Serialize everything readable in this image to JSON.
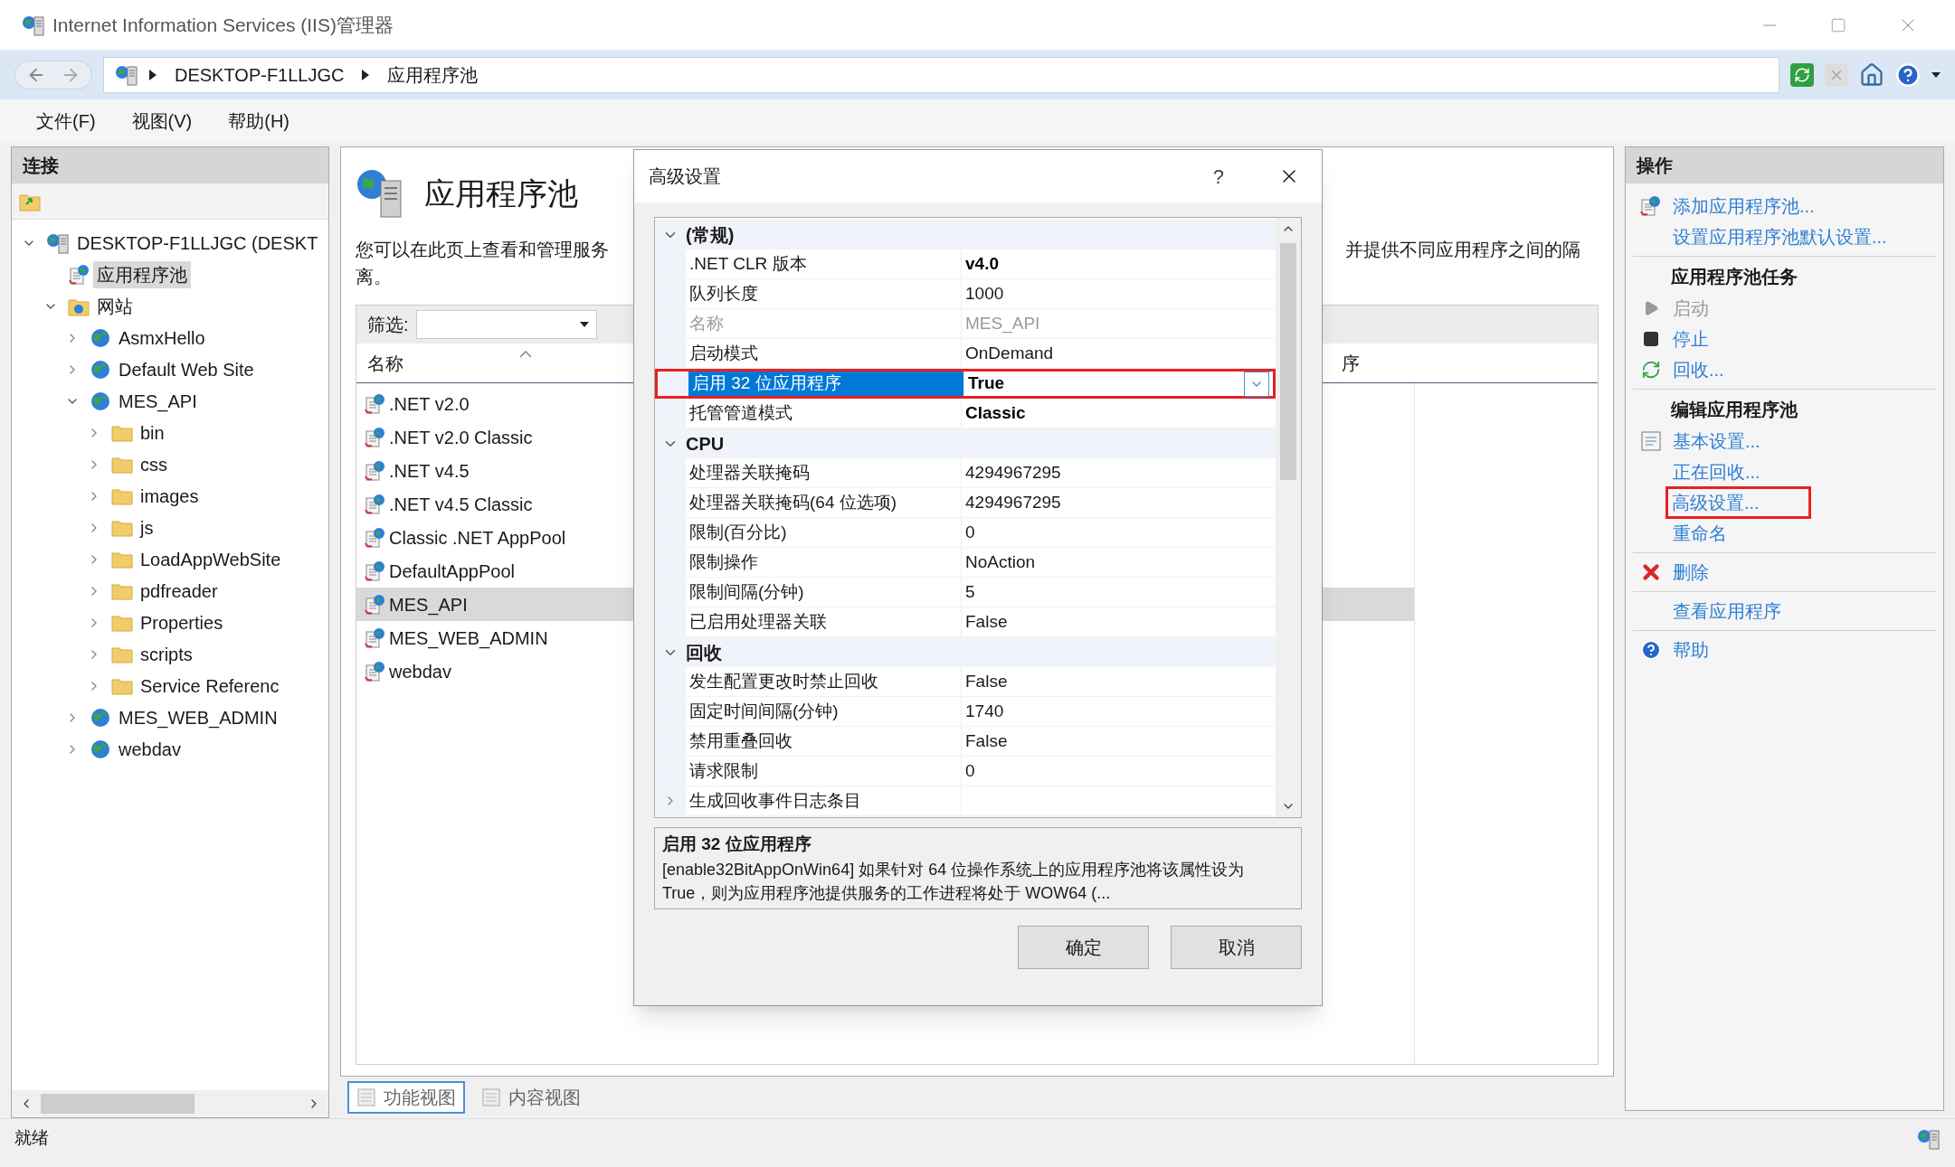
{
  "window": {
    "title": "Internet Information Services (IIS)管理器"
  },
  "address_bar": {
    "segments": [
      "DESKTOP-F1LLJGC",
      "应用程序池"
    ]
  },
  "menu": [
    "文件(F)",
    "视图(V)",
    "帮助(H)"
  ],
  "connections": {
    "title": "连接",
    "tree": [
      {
        "label": "DESKTOP-F1LLJGC (DESKT",
        "kind": "server",
        "expanded": true,
        "selected": false,
        "children": [
          {
            "label": "应用程序池",
            "kind": "pool",
            "selected": true
          },
          {
            "label": "网站",
            "kind": "sites",
            "expanded": true,
            "selected": false,
            "children": [
              {
                "label": "AsmxHello",
                "kind": "site",
                "expanded": false,
                "selected": false
              },
              {
                "label": "Default Web Site",
                "kind": "site",
                "expanded": false,
                "selected": false
              },
              {
                "label": "MES_API",
                "kind": "site",
                "expanded": true,
                "selected": false,
                "children": [
                  {
                    "label": "bin",
                    "kind": "folder",
                    "expanded": false,
                    "selected": false
                  },
                  {
                    "label": "css",
                    "kind": "folder",
                    "expanded": false,
                    "selected": false
                  },
                  {
                    "label": "images",
                    "kind": "folder",
                    "expanded": false,
                    "selected": false
                  },
                  {
                    "label": "js",
                    "kind": "folder",
                    "expanded": false,
                    "selected": false
                  },
                  {
                    "label": "LoadAppWebSite",
                    "kind": "folder",
                    "expanded": false,
                    "selected": false
                  },
                  {
                    "label": "pdfreader",
                    "kind": "folder",
                    "expanded": false,
                    "selected": false
                  },
                  {
                    "label": "Properties",
                    "kind": "folder",
                    "expanded": false,
                    "selected": false
                  },
                  {
                    "label": "scripts",
                    "kind": "folder",
                    "expanded": false,
                    "selected": false
                  },
                  {
                    "label": "Service Referenc",
                    "kind": "folder",
                    "expanded": false,
                    "selected": false
                  }
                ]
              },
              {
                "label": "MES_WEB_ADMIN",
                "kind": "site",
                "expanded": false,
                "selected": false
              },
              {
                "label": "webdav",
                "kind": "site",
                "expanded": false,
                "selected": false
              }
            ]
          }
        ]
      }
    ]
  },
  "page": {
    "title": "应用程序池",
    "description_parts": [
      "您可以在此页上查看和管理服务",
      "并提供不同应用程序之间的隔",
      "离。"
    ],
    "filter": {
      "label": "筛选:"
    },
    "columns": [
      "名称",
      "序"
    ],
    "pools": [
      {
        "name": ".NET v2.0",
        "selected": false
      },
      {
        "name": ".NET v2.0 Classic",
        "selected": false
      },
      {
        "name": ".NET v4.5",
        "selected": false
      },
      {
        "name": ".NET v4.5 Classic",
        "selected": false
      },
      {
        "name": "Classic .NET AppPool",
        "selected": false
      },
      {
        "name": "DefaultAppPool",
        "selected": false
      },
      {
        "name": "MES_API",
        "selected": true
      },
      {
        "name": "MES_WEB_ADMIN",
        "selected": false
      },
      {
        "name": "webdav",
        "selected": false
      }
    ],
    "views": [
      {
        "label": "功能视图",
        "selected": true
      },
      {
        "label": "内容视图",
        "selected": false
      }
    ]
  },
  "actions": {
    "title": "操作",
    "groups": [
      {
        "items": [
          {
            "label": "添加应用程序池...",
            "kind": "add-pool",
            "disabled": false,
            "annotated": false
          },
          {
            "label": "设置应用程序池默认设置...",
            "disabled": false,
            "annotated": false
          }
        ]
      },
      {
        "heading": "应用程序池任务",
        "items": [
          {
            "label": "启动",
            "kind": "play",
            "disabled": true,
            "annotated": false
          },
          {
            "label": "停止",
            "kind": "stop",
            "disabled": false,
            "annotated": false
          },
          {
            "label": "回收...",
            "kind": "recycle",
            "disabled": false,
            "annotated": false
          }
        ]
      },
      {
        "heading": "编辑应用程序池",
        "items": [
          {
            "label": "基本设置...",
            "kind": "sheet",
            "disabled": false,
            "annotated": false
          },
          {
            "label": "正在回收...",
            "disabled": false,
            "annotated": false
          },
          {
            "label": "高级设置...",
            "disabled": false,
            "annotated": true
          },
          {
            "label": "重命名",
            "disabled": false,
            "annotated": false
          }
        ]
      },
      {
        "items": [
          {
            "label": "删除",
            "kind": "delete",
            "disabled": false,
            "annotated": false
          }
        ]
      },
      {
        "items": [
          {
            "label": "查看应用程序",
            "disabled": false,
            "annotated": false
          }
        ]
      },
      {
        "items": [
          {
            "label": "帮助",
            "kind": "help",
            "disabled": false,
            "annotated": false
          }
        ]
      }
    ]
  },
  "dialog": {
    "title": "高级设置",
    "help": "?",
    "categories": [
      {
        "label": "(常规)",
        "expanded": true,
        "rows": [
          {
            "kind": "property",
            "name": ".NET CLR 版本",
            "value": "v4.0",
            "modified": true,
            "disabled": false,
            "selected": false,
            "annotated": false
          },
          {
            "kind": "property",
            "name": "队列长度",
            "value": "1000",
            "modified": false,
            "disabled": false,
            "selected": false,
            "annotated": false
          },
          {
            "kind": "property",
            "name": "名称",
            "value": "MES_API",
            "modified": false,
            "disabled": true,
            "selected": false,
            "annotated": false
          },
          {
            "kind": "property",
            "name": "启动模式",
            "value": "OnDemand",
            "modified": false,
            "disabled": false,
            "selected": false,
            "annotated": false
          },
          {
            "kind": "property",
            "name": "启用 32 位应用程序",
            "value": "True",
            "modified": true,
            "disabled": false,
            "selected": true,
            "annotated": true
          },
          {
            "kind": "property",
            "name": "托管管道模式",
            "value": "Classic",
            "modified": true,
            "disabled": false,
            "selected": false,
            "annotated": false
          }
        ]
      },
      {
        "label": "CPU",
        "expanded": true,
        "rows": [
          {
            "kind": "property",
            "name": "处理器关联掩码",
            "value": "4294967295",
            "modified": false,
            "disabled": false,
            "selected": false,
            "annotated": false
          },
          {
            "kind": "property",
            "name": "处理器关联掩码(64 位选项)",
            "value": "4294967295",
            "modified": false,
            "disabled": false,
            "selected": false,
            "annotated": false
          },
          {
            "kind": "property",
            "name": "限制(百分比)",
            "value": "0",
            "modified": false,
            "disabled": false,
            "selected": false,
            "annotated": false
          },
          {
            "kind": "property",
            "name": "限制操作",
            "value": "NoAction",
            "modified": false,
            "disabled": false,
            "selected": false,
            "annotated": false
          },
          {
            "kind": "property",
            "name": "限制间隔(分钟)",
            "value": "5",
            "modified": false,
            "disabled": false,
            "selected": false,
            "annotated": false
          },
          {
            "kind": "property",
            "name": "已启用处理器关联",
            "value": "False",
            "modified": false,
            "disabled": false,
            "selected": false,
            "annotated": false
          }
        ]
      },
      {
        "label": "回收",
        "expanded": true,
        "rows": [
          {
            "kind": "property",
            "name": "发生配置更改时禁止回收",
            "value": "False",
            "modified": false,
            "disabled": false,
            "selected": false,
            "annotated": false
          },
          {
            "kind": "property",
            "name": "固定时间间隔(分钟)",
            "value": "1740",
            "modified": false,
            "disabled": false,
            "selected": false,
            "annotated": false
          },
          {
            "kind": "property",
            "name": "禁用重叠回收",
            "value": "False",
            "modified": false,
            "disabled": false,
            "selected": false,
            "annotated": false
          },
          {
            "kind": "property",
            "name": "请求限制",
            "value": "0",
            "modified": false,
            "disabled": false,
            "selected": false,
            "annotated": false
          },
          {
            "kind": "group",
            "name": "生成回收事件日志条目",
            "disabled": false,
            "selected": false,
            "annotated": false
          }
        ]
      }
    ],
    "description": {
      "title": "启用 32 位应用程序",
      "text": "[enable32BitAppOnWin64] 如果针对 64 位操作系统上的应用程序池将该属性设为 True，则为应用程序池提供服务的工作进程将处于 WOW64 (..."
    },
    "buttons": [
      "确定",
      "取消"
    ]
  },
  "status_bar": {
    "text": "就绪"
  }
}
